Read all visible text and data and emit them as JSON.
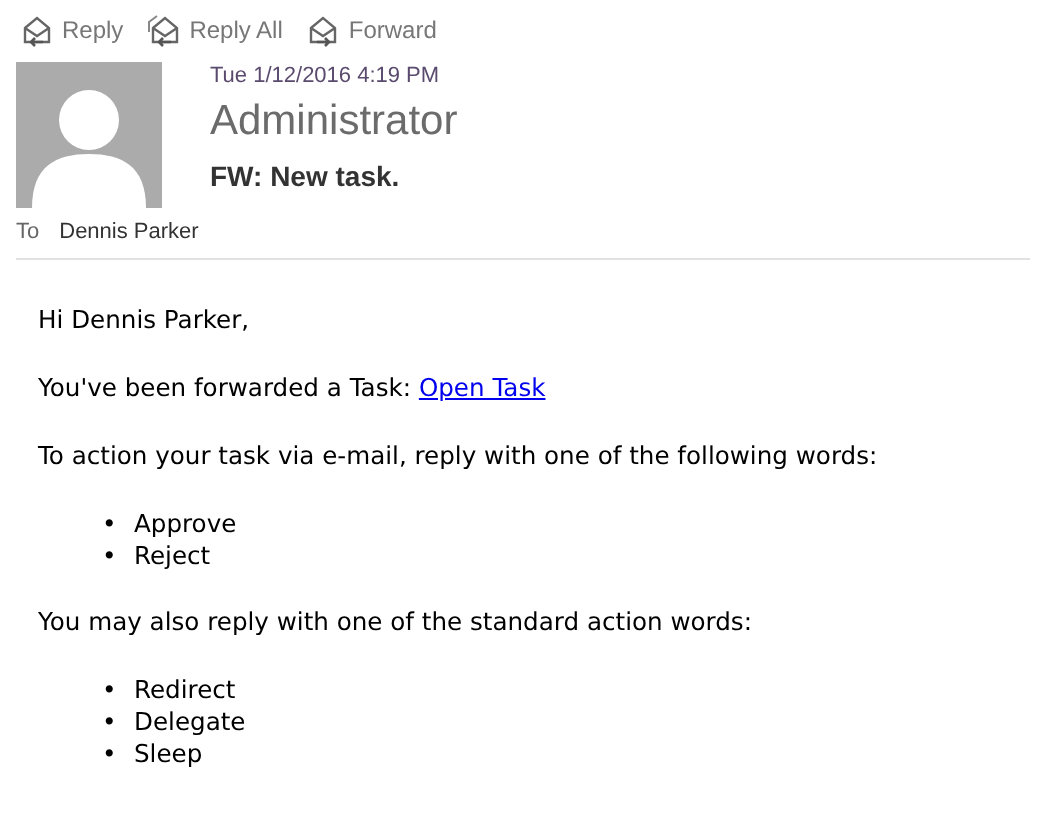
{
  "toolbar": [
    {
      "label": "Reply",
      "kind": "reply"
    },
    {
      "label": "Reply All",
      "kind": "reply-all"
    },
    {
      "label": "Forward",
      "kind": "forward"
    }
  ],
  "message": {
    "date": "Tue 1/12/2016 4:19 PM",
    "sender": "Administrator",
    "subject": "FW: New task.",
    "to_label": "To",
    "to": "Dennis Parker"
  },
  "body": [
    {
      "kind": "paragraph",
      "text": "Hi Dennis Parker,"
    },
    {
      "kind": "paragraph",
      "text": "You've been forwarded a Task: ",
      "link": "Open Task"
    },
    {
      "kind": "paragraph",
      "text": "To action your task via e-mail, reply with one of the following words:"
    },
    {
      "kind": "list",
      "items": [
        {
          "marker": "•",
          "text": "Approve"
        },
        {
          "marker": "•",
          "text": "Reject"
        }
      ]
    },
    {
      "kind": "paragraph",
      "text": "You may also reply with one of the standard action words:"
    },
    {
      "kind": "list",
      "items": [
        {
          "marker": "•",
          "text": "Redirect"
        },
        {
          "marker": "•",
          "text": "Delegate"
        },
        {
          "marker": "•",
          "text": "Sleep"
        }
      ]
    }
  ]
}
